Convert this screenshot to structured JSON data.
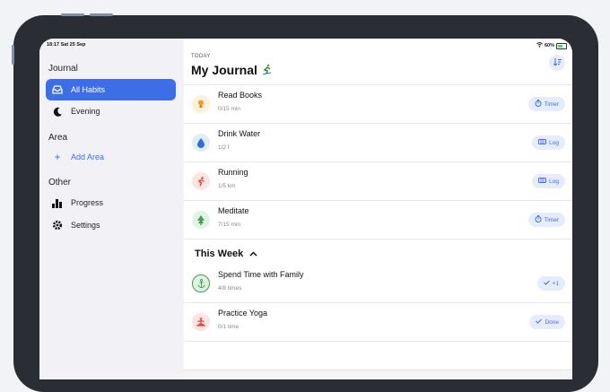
{
  "status": {
    "time_date": "18:17  Sat 25 Sep",
    "battery": "60%"
  },
  "sidebar": {
    "journal_header": "Journal",
    "items": [
      {
        "label": "All Habits",
        "icon": "tray-icon",
        "selected": true
      },
      {
        "label": "Evening",
        "icon": "moon-icon",
        "selected": false
      }
    ],
    "area_header": "Area",
    "add_area": "Add Area",
    "other_header": "Other",
    "other_items": [
      {
        "label": "Progress",
        "icon": "bar-chart-icon"
      },
      {
        "label": "Settings",
        "icon": "gear-icon"
      }
    ]
  },
  "main": {
    "today_label": "TODAY",
    "title": "My Journal",
    "today_habits": [
      {
        "name": "Read Books",
        "progress": "0/15 min",
        "action": "Timer",
        "icon": "lightbulb-icon",
        "color": "#f0a020"
      },
      {
        "name": "Drink Water",
        "progress": "1/2 l",
        "action": "Log",
        "icon": "water-drop-icon",
        "color": "#2e6fd8"
      },
      {
        "name": "Running",
        "progress": "1/5 km",
        "action": "Log",
        "icon": "running-icon",
        "color": "#e0473a"
      },
      {
        "name": "Meditate",
        "progress": "7/15 min",
        "action": "Timer",
        "icon": "tree-icon",
        "color": "#3aa04a"
      }
    ],
    "week_header": "This Week",
    "week_habits": [
      {
        "name": "Spend Time with Family",
        "progress": "4/8 times",
        "action": "+1",
        "icon": "anchor-icon",
        "color": "#3aa04a"
      },
      {
        "name": "Practice Yoga",
        "progress": "0/1 time",
        "action": "Done",
        "icon": "yoga-icon",
        "color": "#e0473a"
      }
    ]
  }
}
